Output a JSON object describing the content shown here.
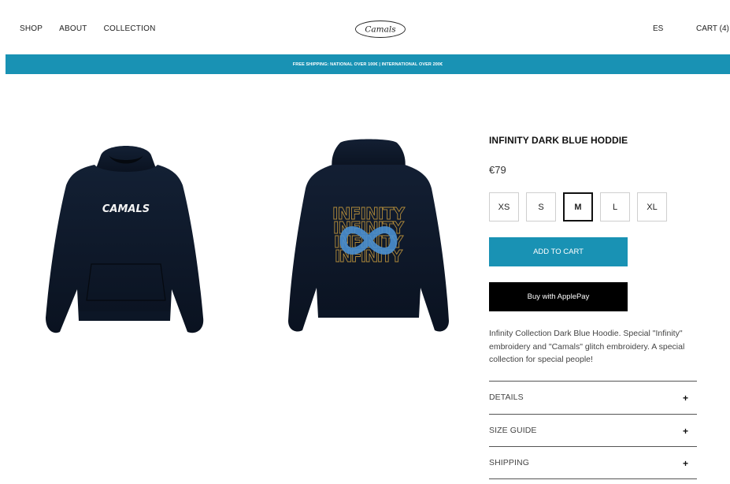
{
  "nav": {
    "items": [
      "SHOP",
      "ABOUT",
      "COLLECTION"
    ],
    "logo_text": "Camals",
    "language": "ES",
    "cart": "CART (4)"
  },
  "banner": {
    "text": "FREE SHIPPING: NATIONAL OVER 100€ | INTERNATIONAL OVER 200€"
  },
  "product": {
    "front_print": "CAMALS",
    "back_print": "INFINITY",
    "title": "INFINITY DARK BLUE HODDIE",
    "price": "€79",
    "sizes": [
      "XS",
      "S",
      "M",
      "L",
      "XL"
    ],
    "selected_size": "M",
    "add_to_cart": "ADD TO CART",
    "buy_apple_pay": "Buy with ApplePay",
    "description": "Infinity Collection Dark Blue Hoodie. Special \"Infinity\" embroidery and \"Camals\" glitch embroidery. A special collection for special people!",
    "accordion": [
      "DETAILS",
      "SIZE GUIDE",
      "SHIPPING"
    ]
  },
  "colors": {
    "accent": "#1992b4",
    "hoodie": "#0e1828",
    "embroidery_gold": "#b08a3a",
    "embroidery_blue": "#4a8fd0"
  }
}
